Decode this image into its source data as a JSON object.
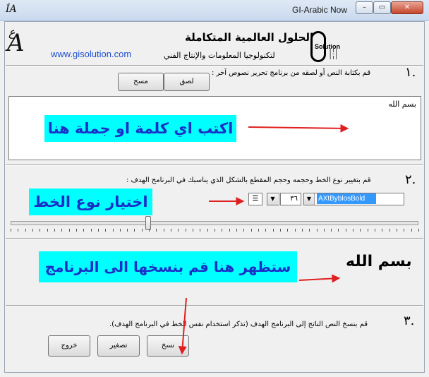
{
  "window": {
    "title": "GI-Arabic Now",
    "minimize_glyph": "–",
    "maximize_glyph": "▭",
    "close_glyph": "✕"
  },
  "header": {
    "logo_text": "A",
    "logo_small": "ع",
    "website": "www.gisolution.com",
    "company_title": "الحلول العالمية المتكاملة",
    "company_subtitle": "لتكنولوجيا المعلومات والإنتاج الفني",
    "logo_word": "Solution"
  },
  "step1": {
    "number": "١.",
    "instruction": "قم بكتابة النص أو لصقه من برنامج تحرير نصوص آخر :",
    "paste_label": "لصق",
    "clear_label": "مسح"
  },
  "input": {
    "text": "بسم الله",
    "callout": "اكتب اي كلمة او جملة هنا"
  },
  "step2": {
    "number": "٢.",
    "instruction": "قم بتغيير نوع الخط وحجمه وحجم المقطع بالشكل الذي يناسبك في البرنامج الهدف :",
    "font_size": "٣٦",
    "font_name": "AXtByblosBold",
    "callout": "اختيار نوع الخط"
  },
  "preview": {
    "text": "بسم الله",
    "callout": "ستظهر هنا قم بنسخها الى البرنامج"
  },
  "step3": {
    "number": "٣.",
    "instruction": "قم بنسخ النص الناتج إلى البرنامج الهدف (تذكر استخدام نفس الخط في البرنامج الهدف).",
    "copy_label": "نسخ",
    "minimize_label": "تصغير",
    "exit_label": "خروج"
  },
  "colors": {
    "callout_bg": "#00ffff",
    "callout_text": "#1a2fc8",
    "arrow": "#e02020",
    "link": "#1f4fd1",
    "selection": "#3399ff"
  },
  "icons": {
    "app": "gi-logo-icon",
    "align": "align-lines-icon",
    "dropdown": "chevron-down-icon"
  }
}
